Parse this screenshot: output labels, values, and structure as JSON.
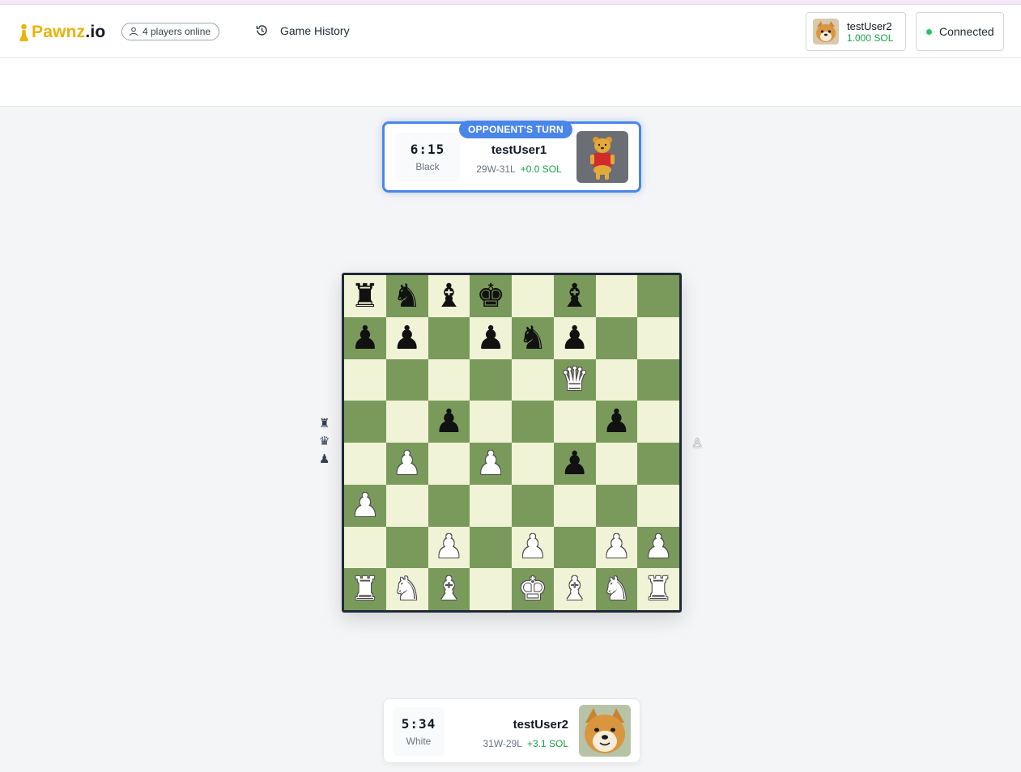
{
  "nav": {
    "brand_main": "Pawnz",
    "brand_tld": ".io",
    "online": "4 players online",
    "history": "Game History",
    "user": {
      "name": "testUser2",
      "balance": "1.000 SOL"
    },
    "connection": "Connected"
  },
  "opponent": {
    "badge": "OPPONENT'S TURN",
    "time": "6:15",
    "side": "Black",
    "name": "testUser1",
    "record": "29W-31L",
    "gain": "+0.0 SOL",
    "avatar": "bear-avatar"
  },
  "player": {
    "time": "5:34",
    "side": "White",
    "name": "testUser2",
    "record": "31W-29L",
    "gain": "+3.1 SOL",
    "avatar": "shiba-avatar"
  },
  "board": {
    "ranks": [
      [
        "bR",
        "bN",
        "bB",
        "bK",
        "",
        "bB",
        "",
        ""
      ],
      [
        "bP",
        "bP",
        "",
        "bP",
        "bN",
        "bP",
        "",
        ""
      ],
      [
        "",
        "",
        "",
        "",
        "",
        "wQ",
        "",
        ""
      ],
      [
        "",
        "",
        "bP",
        "",
        "",
        "",
        "bP",
        ""
      ],
      [
        "",
        "wP",
        "",
        "wP",
        "",
        "bP",
        "",
        ""
      ],
      [
        "wP",
        "",
        "",
        "",
        "",
        "",
        "",
        ""
      ],
      [
        "",
        "",
        "wP",
        "",
        "wP",
        "",
        "wP",
        "wP"
      ],
      [
        "wR",
        "wN",
        "wB",
        "",
        "wK",
        "wB",
        "wN",
        "wR"
      ]
    ]
  },
  "captured": {
    "by_white": [
      "♜",
      "♛",
      "♟"
    ],
    "by_black": [
      "♙"
    ]
  },
  "colors": {
    "light_square": "#f1f3d6",
    "dark_square": "#7a9a5c",
    "accent": "#4a86e8",
    "gain": "#16a34a",
    "brand": "#eab308"
  }
}
